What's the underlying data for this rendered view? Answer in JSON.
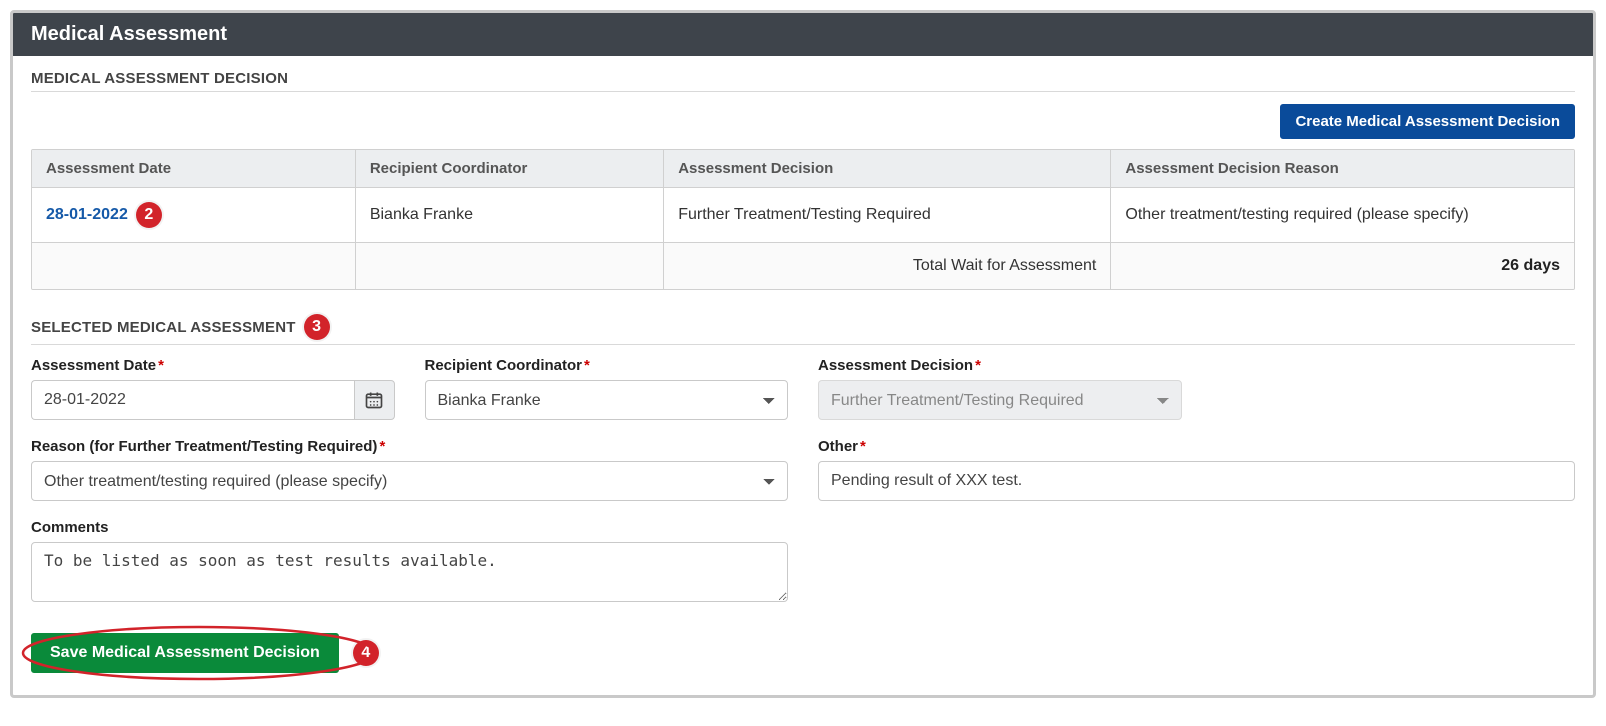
{
  "panel": {
    "title": "Medical Assessment"
  },
  "decision_section": {
    "title": "MEDICAL ASSESSMENT DECISION",
    "create_button": "Create Medical Assessment Decision",
    "columns": {
      "date": "Assessment Date",
      "coord": "Recipient Coordinator",
      "decision": "Assessment Decision",
      "reason": "Assessment Decision Reason"
    },
    "row": {
      "date": "28-01-2022",
      "coord": "Bianka Franke",
      "decision": "Further Treatment/Testing Required",
      "reason": "Other treatment/testing required (please specify)"
    },
    "footer": {
      "label": "Total Wait for Assessment",
      "value": "26 days"
    }
  },
  "selected_section": {
    "title": "SELECTED MEDICAL ASSESSMENT"
  },
  "form": {
    "assessment_date": {
      "label": "Assessment Date",
      "value": "28-01-2022"
    },
    "recipient_coordinator": {
      "label": "Recipient Coordinator",
      "value": "Bianka Franke"
    },
    "assessment_decision": {
      "label": "Assessment Decision",
      "value": "Further Treatment/Testing Required"
    },
    "reason": {
      "label": "Reason (for Further Treatment/Testing Required)",
      "value": "Other treatment/testing required (please specify)"
    },
    "other": {
      "label": "Other",
      "value": "Pending result of XXX test."
    },
    "comments": {
      "label": "Comments",
      "value": "To be listed as soon as test results available."
    }
  },
  "save_button": "Save Medical Assessment Decision",
  "annotations": {
    "row": "2",
    "title": "3",
    "save": "4"
  }
}
